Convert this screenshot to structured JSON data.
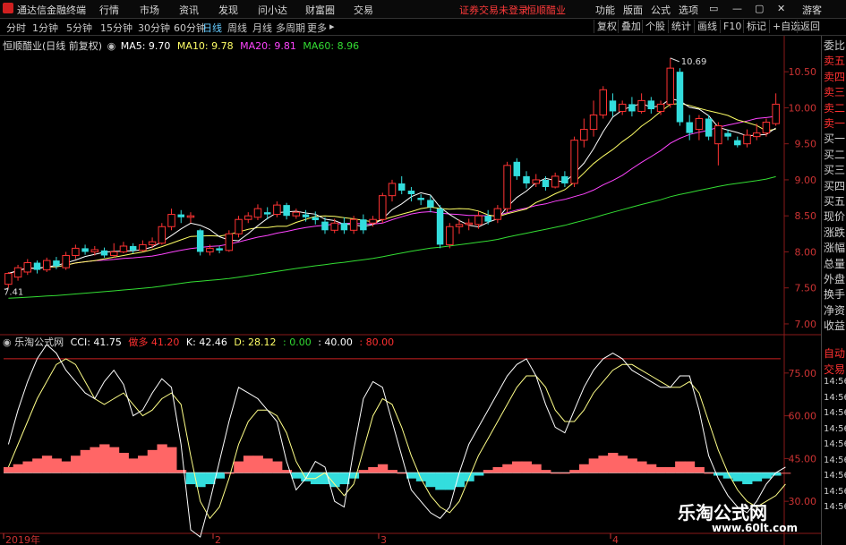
{
  "menu": {
    "app_name": "通达信金融终端",
    "items": [
      "行情",
      "市场",
      "资讯",
      "发现",
      "问小达",
      "财富圈",
      "交易"
    ],
    "notice": "证券交易未登录",
    "stock": "恒顺醋业",
    "right_items": [
      "功能",
      "版面",
      "公式",
      "选项"
    ],
    "user": "游客",
    "window_buttons": [
      "▭",
      "—",
      "▢",
      "✕"
    ]
  },
  "toolbar": {
    "periods": [
      "分时",
      "1分钟",
      "5分钟",
      "15分钟",
      "30分钟",
      "60分钟",
      "日线",
      "周线",
      "月线",
      "多周期",
      "更多"
    ],
    "active_period": "日线",
    "right_buttons": [
      "复权",
      "叠加",
      "个股",
      "统计",
      "画线",
      "F10",
      "标记",
      "+自选",
      "返回"
    ]
  },
  "main_chart": {
    "title": "恒顺醋业(日线 前复权)",
    "ma": [
      {
        "label": "MA5: 9.70",
        "color": "#ffffff"
      },
      {
        "label": "MA10: 9.78",
        "color": "#ffff66"
      },
      {
        "label": "MA20: 9.81",
        "color": "#ff44ff"
      },
      {
        "label": "MA60: 8.96",
        "color": "#33dd33"
      }
    ],
    "high_annotation": "10.69",
    "low_annotation": "7.41",
    "y_ticks": [
      "10.50",
      "10.00",
      "9.50",
      "9.00",
      "8.50",
      "8.00",
      "7.50",
      "7.00"
    ]
  },
  "sub_chart": {
    "title": "乐淘公式网",
    "cci": "CCI: 41.75",
    "label_red": "做多",
    "value_red": "41.20",
    "k": "K: 42.46",
    "d": "D: 28.12",
    "g1": ": 0.00",
    "g2": ": 40.00",
    "r1": ": 80.00",
    "y_ticks": [
      "75.00",
      "60.00",
      "45.00",
      "30.00"
    ]
  },
  "x_axis": [
    "2019年",
    "2",
    "3",
    "4"
  ],
  "right_panel": {
    "labels": [
      "委比",
      "卖五",
      "卖四",
      "卖三",
      "卖二",
      "卖一",
      "买一",
      "买二",
      "买三",
      "买四",
      "买五",
      "现价",
      "涨跌",
      "涨幅",
      "总量",
      "外盘",
      "换手",
      "净资",
      "收益"
    ],
    "sub_labels": [
      "自动",
      "交易",
      "14:56",
      "14:56",
      "14:56",
      "14:56",
      "14:56",
      "14:56",
      "14:56",
      "14:56",
      "14:56"
    ]
  },
  "watermark": {
    "name": "乐淘公式网",
    "url": "www.60lt.com"
  },
  "colors": {
    "up": "#ff3333",
    "down": "#33dddd",
    "ma5": "#ffffff",
    "ma10": "#ffff66",
    "ma20": "#ff44ff",
    "ma60": "#33dd33"
  },
  "chart_data": [
    {
      "type": "candlestick",
      "ylim": [
        6.9,
        10.85
      ],
      "y_ticks": [
        10.5,
        10.0,
        9.5,
        9.0,
        8.5,
        8.0,
        7.5,
        7.0
      ],
      "candles": [
        [
          7.55,
          7.7,
          7.5,
          7.72
        ],
        [
          7.65,
          7.78,
          7.6,
          7.82
        ],
        [
          7.72,
          7.85,
          7.68,
          7.9
        ],
        [
          7.85,
          7.75,
          7.7,
          7.88
        ],
        [
          7.75,
          7.88,
          7.72,
          7.92
        ],
        [
          7.88,
          7.8,
          7.76,
          7.93
        ],
        [
          7.78,
          7.95,
          7.75,
          8.0
        ],
        [
          7.95,
          8.05,
          7.9,
          8.1
        ],
        [
          8.05,
          8.0,
          7.96,
          8.1
        ],
        [
          8.0,
          8.03,
          7.95,
          8.08
        ],
        [
          8.02,
          7.95,
          7.92,
          8.06
        ],
        [
          7.95,
          8.0,
          7.92,
          8.12
        ],
        [
          8.0,
          8.08,
          7.98,
          8.14
        ],
        [
          8.08,
          8.02,
          7.98,
          8.12
        ],
        [
          8.02,
          8.1,
          8.0,
          8.16
        ],
        [
          8.1,
          8.14,
          8.05,
          8.2
        ],
        [
          8.12,
          8.35,
          8.1,
          8.4
        ],
        [
          8.35,
          8.52,
          8.3,
          8.6
        ],
        [
          8.52,
          8.48,
          8.4,
          8.58
        ],
        [
          8.48,
          8.5,
          8.4,
          8.55
        ],
        [
          8.3,
          8.0,
          7.95,
          8.32
        ],
        [
          8.0,
          8.05,
          7.95,
          8.1
        ],
        [
          8.05,
          8.02,
          7.98,
          8.08
        ],
        [
          8.02,
          8.25,
          8.0,
          8.3
        ],
        [
          8.25,
          8.45,
          8.2,
          8.5
        ],
        [
          8.45,
          8.5,
          8.4,
          8.55
        ],
        [
          8.48,
          8.6,
          8.44,
          8.66
        ],
        [
          8.55,
          8.52,
          8.45,
          8.62
        ],
        [
          8.52,
          8.65,
          8.48,
          8.7
        ],
        [
          8.65,
          8.5,
          8.45,
          8.68
        ],
        [
          8.5,
          8.55,
          8.46,
          8.6
        ],
        [
          8.52,
          8.48,
          8.42,
          8.58
        ],
        [
          8.48,
          8.44,
          8.38,
          8.56
        ],
        [
          8.42,
          8.3,
          8.25,
          8.48
        ],
        [
          8.3,
          8.4,
          8.26,
          8.46
        ],
        [
          8.4,
          8.3,
          8.25,
          8.48
        ],
        [
          8.3,
          8.45,
          8.25,
          8.5
        ],
        [
          8.45,
          8.3,
          8.25,
          8.52
        ],
        [
          8.4,
          8.45,
          8.35,
          8.5
        ],
        [
          8.45,
          8.78,
          8.4,
          8.82
        ],
        [
          8.78,
          8.95,
          8.7,
          9.0
        ],
        [
          8.95,
          8.85,
          8.8,
          9.05
        ],
        [
          8.85,
          8.8,
          8.7,
          8.9
        ],
        [
          8.75,
          8.72,
          8.65,
          8.8
        ],
        [
          8.72,
          8.62,
          8.55,
          8.78
        ],
        [
          8.6,
          8.1,
          8.05,
          8.65
        ],
        [
          8.1,
          8.35,
          8.05,
          8.4
        ],
        [
          8.35,
          8.38,
          8.25,
          8.45
        ],
        [
          8.38,
          8.4,
          8.3,
          8.46
        ],
        [
          8.38,
          8.5,
          8.32,
          8.56
        ],
        [
          8.5,
          8.42,
          8.38,
          8.58
        ],
        [
          8.45,
          8.6,
          8.4,
          8.65
        ],
        [
          8.6,
          9.2,
          8.55,
          9.25
        ],
        [
          9.25,
          9.05,
          9.0,
          9.3
        ],
        [
          9.05,
          8.95,
          8.88,
          9.12
        ],
        [
          8.95,
          9.0,
          8.9,
          9.08
        ],
        [
          9.0,
          8.9,
          8.85,
          9.05
        ],
        [
          8.9,
          9.05,
          8.88,
          9.1
        ],
        [
          9.05,
          8.95,
          8.9,
          9.12
        ],
        [
          8.95,
          9.55,
          8.9,
          9.6
        ],
        [
          9.55,
          9.7,
          9.45,
          9.85
        ],
        [
          9.7,
          9.9,
          9.6,
          10.1
        ],
        [
          9.9,
          10.25,
          9.85,
          10.3
        ],
        [
          10.1,
          9.95,
          9.88,
          10.2
        ],
        [
          9.95,
          10.05,
          9.9,
          10.1
        ],
        [
          10.05,
          9.95,
          9.88,
          10.15
        ],
        [
          9.95,
          10.1,
          9.92,
          10.2
        ],
        [
          10.1,
          9.98,
          9.92,
          10.15
        ],
        [
          9.95,
          10.05,
          9.9,
          10.1
        ],
        [
          10.05,
          10.55,
          10.0,
          10.69
        ],
        [
          10.5,
          9.8,
          9.75,
          10.55
        ],
        [
          9.8,
          9.65,
          9.55,
          9.9
        ],
        [
          9.7,
          9.85,
          9.55,
          9.9
        ],
        [
          9.85,
          9.6,
          9.55,
          9.9
        ],
        [
          9.5,
          9.75,
          9.2,
          9.8
        ],
        [
          9.65,
          9.6,
          9.55,
          9.7
        ],
        [
          9.55,
          9.48,
          9.45,
          9.6
        ],
        [
          9.5,
          9.62,
          9.45,
          9.7
        ],
        [
          9.6,
          9.65,
          9.55,
          9.78
        ],
        [
          9.65,
          9.8,
          9.6,
          9.85
        ],
        [
          9.78,
          10.05,
          9.75,
          10.2
        ]
      ]
    },
    {
      "type": "area",
      "ylim": [
        20,
        85
      ],
      "y_ticks": [
        75,
        60,
        45,
        30
      ],
      "reference_lines": [
        0,
        40,
        80
      ],
      "signal": [
        42,
        43,
        44,
        45,
        46,
        45,
        44,
        46,
        48,
        49,
        50,
        49,
        47,
        45,
        46,
        48,
        50,
        49,
        41,
        36,
        35,
        36,
        38,
        40,
        44,
        46,
        46,
        45,
        44,
        41,
        38,
        37,
        36,
        36,
        35,
        36,
        38,
        41,
        42,
        43,
        41,
        40,
        38,
        37,
        35,
        34,
        34,
        35,
        37,
        39,
        41,
        42,
        43,
        44,
        44,
        43,
        41,
        40,
        40,
        41,
        43,
        45,
        46,
        47,
        46,
        45,
        44,
        43,
        42,
        42,
        44,
        44,
        42,
        40,
        39,
        38,
        37,
        36,
        37,
        38,
        39,
        40
      ],
      "line_white": [
        50,
        62,
        72,
        80,
        85,
        82,
        76,
        72,
        68,
        66,
        72,
        76,
        71,
        60,
        62,
        68,
        73,
        70,
        50,
        20,
        16,
        30,
        44,
        58,
        70,
        68,
        66,
        62,
        58,
        44,
        34,
        38,
        44,
        42,
        30,
        28,
        48,
        66,
        72,
        70,
        58,
        46,
        34,
        30,
        26,
        24,
        28,
        40,
        50,
        56,
        62,
        68,
        74,
        78,
        80,
        74,
        64,
        56,
        54,
        62,
        70,
        76,
        80,
        82,
        80,
        76,
        74,
        72,
        70,
        70,
        74,
        74,
        62,
        46,
        38,
        32,
        28,
        26,
        30,
        36,
        40,
        42
      ],
      "line_yellow": [
        42,
        50,
        58,
        66,
        72,
        78,
        80,
        78,
        72,
        66,
        64,
        66,
        68,
        64,
        60,
        62,
        66,
        68,
        64,
        46,
        30,
        24,
        28,
        38,
        50,
        58,
        62,
        62,
        60,
        54,
        44,
        38,
        38,
        40,
        36,
        32,
        36,
        48,
        60,
        66,
        64,
        56,
        46,
        38,
        32,
        28,
        26,
        30,
        38,
        46,
        52,
        58,
        64,
        70,
        74,
        74,
        70,
        62,
        58,
        58,
        62,
        68,
        72,
        76,
        78,
        78,
        76,
        74,
        72,
        70,
        70,
        72,
        68,
        58,
        48,
        40,
        34,
        30,
        28,
        30,
        32,
        36
      ]
    }
  ]
}
